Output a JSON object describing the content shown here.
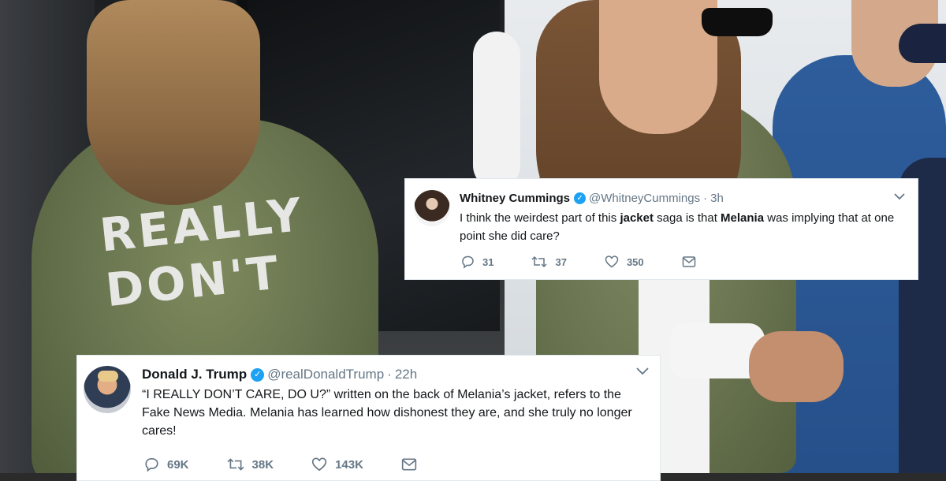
{
  "tweets": [
    {
      "name": "Whitney Cummings",
      "verified_mark": "✓",
      "handle": "@WhitneyCummings",
      "separator": "·",
      "time": "3h",
      "text_parts": [
        "I think the weirdest part of this ",
        "jacket",
        " saga is that ",
        "Melania",
        " was implying that at one point she did care?"
      ],
      "replies": "31",
      "retweets": "37",
      "likes": "350",
      "icons": [
        "reply-icon",
        "retweet-icon",
        "like-icon",
        "message-icon",
        "chevron-down-icon"
      ]
    },
    {
      "name": "Donald J. Trump",
      "verified_mark": "✓",
      "handle": "@realDonaldTrump",
      "separator": "·",
      "time": "22h",
      "text": "“I REALLY DON’T CARE, DO U?” written on the back of Melania’s jacket, refers to the Fake News Media. Melania has learned how dishonest they are, and she truly no longer cares!",
      "replies": "69K",
      "retweets": "38K",
      "likes": "143K",
      "icons": [
        "reply-icon",
        "retweet-icon",
        "like-icon",
        "message-icon",
        "chevron-down-icon"
      ]
    }
  ],
  "background": {
    "jacket_lettering": "REALLY DON'T",
    "colors": {
      "jacket": "#6b7551",
      "verified": "#1da1f2",
      "muted": "#657786"
    }
  }
}
